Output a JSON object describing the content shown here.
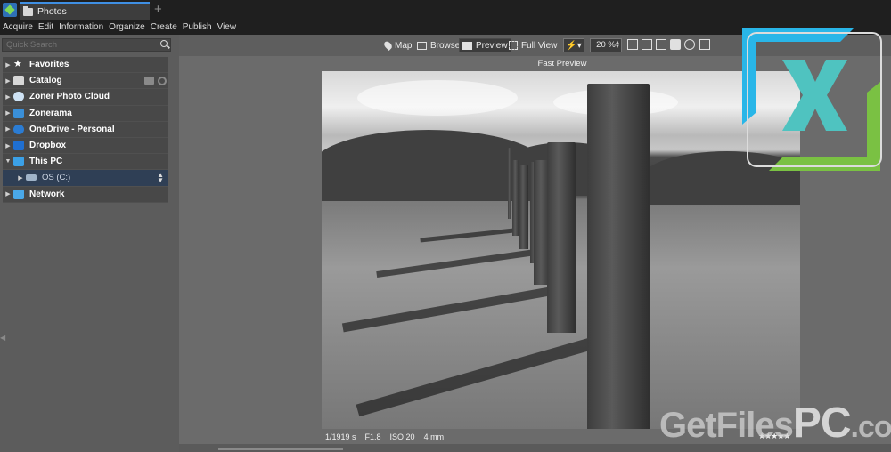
{
  "window": {
    "tab_title": "Photos",
    "tab_add": "+"
  },
  "menu": [
    "Acquire",
    "Edit",
    "Information",
    "Organize",
    "Create",
    "Publish",
    "View"
  ],
  "sidebar": {
    "search_placeholder": "Quick Search",
    "items": [
      {
        "label": "Favorites",
        "icon": "star-icon"
      },
      {
        "label": "Catalog",
        "icon": "catalog-icon"
      },
      {
        "label": "Zoner Photo Cloud",
        "icon": "cloud-icon"
      },
      {
        "label": "Zonerama",
        "icon": "zonerama-icon"
      },
      {
        "label": "OneDrive - Personal",
        "icon": "onedrive-icon"
      },
      {
        "label": "Dropbox",
        "icon": "dropbox-icon"
      },
      {
        "label": "This PC",
        "icon": "computer-icon"
      },
      {
        "label": "OS (C:)",
        "icon": "drive-icon"
      },
      {
        "label": "Network",
        "icon": "network-icon"
      }
    ]
  },
  "toolbar": {
    "map": "Map",
    "browser": "Browser",
    "preview": "Preview",
    "full_view": "Full View",
    "zoom": "20 %",
    "flash": "⚡"
  },
  "canvas": {
    "title": "Fast Preview"
  },
  "photo_meta": {
    "shutter": "1/1919 s",
    "aperture": "F1.8",
    "iso": "ISO 20",
    "focal": "4 mm",
    "rating": "★★★★★"
  },
  "watermark": {
    "main": "GetFiles",
    "pc": "PC",
    "tld": ".com"
  },
  "colors": {
    "accent": "#3f8fe3",
    "logo_blue": "#29b6e8",
    "logo_green": "#7ac143"
  }
}
